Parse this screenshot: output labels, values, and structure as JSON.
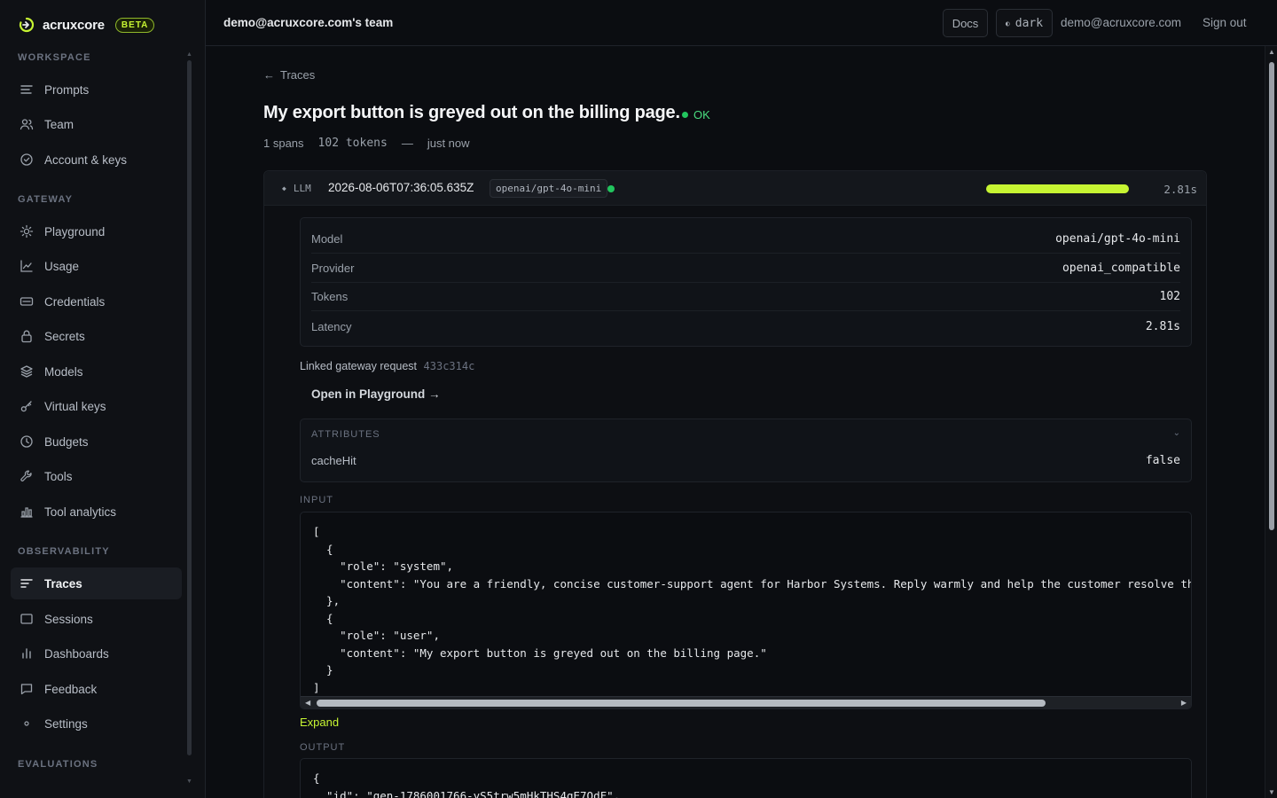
{
  "brand": {
    "name": "acruxcore",
    "badge": "BETA"
  },
  "sidebar": {
    "sections": [
      {
        "label": "WORKSPACE",
        "items": [
          {
            "label": "Prompts",
            "icon": "list-icon"
          },
          {
            "label": "Team",
            "icon": "users-icon"
          },
          {
            "label": "Account & keys",
            "icon": "check-circle-icon"
          }
        ]
      },
      {
        "label": "GATEWAY",
        "items": [
          {
            "label": "Playground",
            "icon": "sun-icon"
          },
          {
            "label": "Usage",
            "icon": "line-chart-icon"
          },
          {
            "label": "Credentials",
            "icon": "card-icon"
          },
          {
            "label": "Secrets",
            "icon": "lock-icon"
          },
          {
            "label": "Models",
            "icon": "layers-icon"
          },
          {
            "label": "Virtual keys",
            "icon": "key-icon"
          },
          {
            "label": "Budgets",
            "icon": "clock-icon"
          },
          {
            "label": "Tools",
            "icon": "wrench-icon"
          },
          {
            "label": "Tool analytics",
            "icon": "bar-chart-icon"
          }
        ]
      },
      {
        "label": "OBSERVABILITY",
        "items": [
          {
            "label": "Traces",
            "icon": "traces-icon",
            "active": true
          },
          {
            "label": "Sessions",
            "icon": "window-icon"
          },
          {
            "label": "Dashboards",
            "icon": "bars-icon"
          },
          {
            "label": "Feedback",
            "icon": "message-icon"
          },
          {
            "label": "Settings",
            "icon": "dot-icon"
          }
        ]
      },
      {
        "label": "EVALUATIONS",
        "items": []
      }
    ]
  },
  "topbar": {
    "team": "demo@acruxcore.com's team",
    "docs": "Docs",
    "theme": "dark",
    "email": "demo@acruxcore.com",
    "signout": "Sign out"
  },
  "trace": {
    "back": "Traces",
    "title": "My export button is greyed out on the billing page.",
    "status": "OK",
    "spans": "1 spans",
    "tokens": "102 tokens",
    "dash": "—",
    "when": "just now"
  },
  "span": {
    "kind": "LLM",
    "timestamp": "2026-08-06T07:36:05.635Z",
    "model": "openai/gpt-4o-mini",
    "duration": "2.81s",
    "details": [
      {
        "key": "Model",
        "value": "openai/gpt-4o-mini"
      },
      {
        "key": "Provider",
        "value": "openai_compatible"
      },
      {
        "key": "Tokens",
        "value": "102"
      },
      {
        "key": "Latency",
        "value": "2.81s"
      }
    ],
    "linked_label": "Linked gateway request",
    "linked_id": "433c314c",
    "open_playground": "Open in Playground →",
    "attributes_title": "ATTRIBUTES",
    "attributes": [
      {
        "key": "cacheHit",
        "value": "false"
      }
    ],
    "input_label": "INPUT",
    "input_code": "[\n  {\n    \"role\": \"system\",\n    \"content\": \"You are a friendly, concise customer-support agent for Harbor Systems. Reply warmly and help the customer resolve their issue.\"\n  },\n  {\n    \"role\": \"user\",\n    \"content\": \"My export button is greyed out on the billing page.\"\n  }\n]",
    "expand": "Expand",
    "output_label": "OUTPUT",
    "output_code": "{\n  \"id\": \"gen-1786001766-yS5trw5mHkTHS4gE7QdF\","
  },
  "colors": {
    "accent": "#c6f432",
    "ok": "#22c55e",
    "bg": "#0b0d11"
  }
}
